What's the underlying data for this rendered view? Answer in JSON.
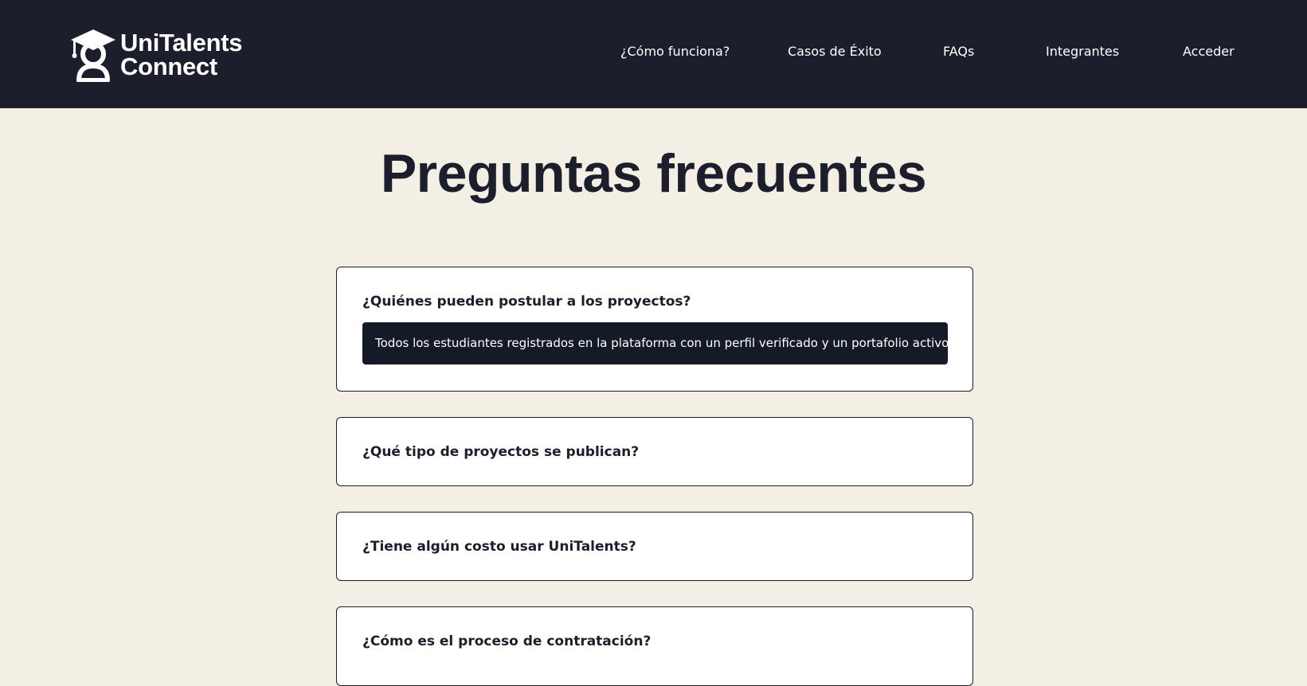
{
  "brand": {
    "line1": "UniTalents",
    "line2": "Connect",
    "icon": "graduate-cap-person-icon"
  },
  "nav": {
    "items": [
      {
        "label": "¿Cómo funciona?"
      },
      {
        "label": "Casos de Éxito"
      },
      {
        "label": "FAQs"
      },
      {
        "label": "Integrantes"
      },
      {
        "label": "Acceder"
      }
    ]
  },
  "page": {
    "title": "Preguntas frecuentes"
  },
  "faqs": [
    {
      "question": "¿Quiénes pueden postular a los proyectos?",
      "answer": "Todos los estudiantes registrados en la plataforma con un perfil verificado y un portafolio activo.",
      "expanded": true
    },
    {
      "question": "¿Qué tipo de proyectos se publican?",
      "expanded": false
    },
    {
      "question": "¿Tiene algún costo usar UniTalents?",
      "expanded": false
    },
    {
      "question": "¿Cómo es el proceso de contratación?",
      "expanded": false
    }
  ],
  "colors": {
    "navbar_bg": "#1c1e2b",
    "page_bg": "#f4efe4",
    "answer_bg": "#141a26",
    "text_dark": "#1c1e2b",
    "text_light": "#ffffff"
  }
}
